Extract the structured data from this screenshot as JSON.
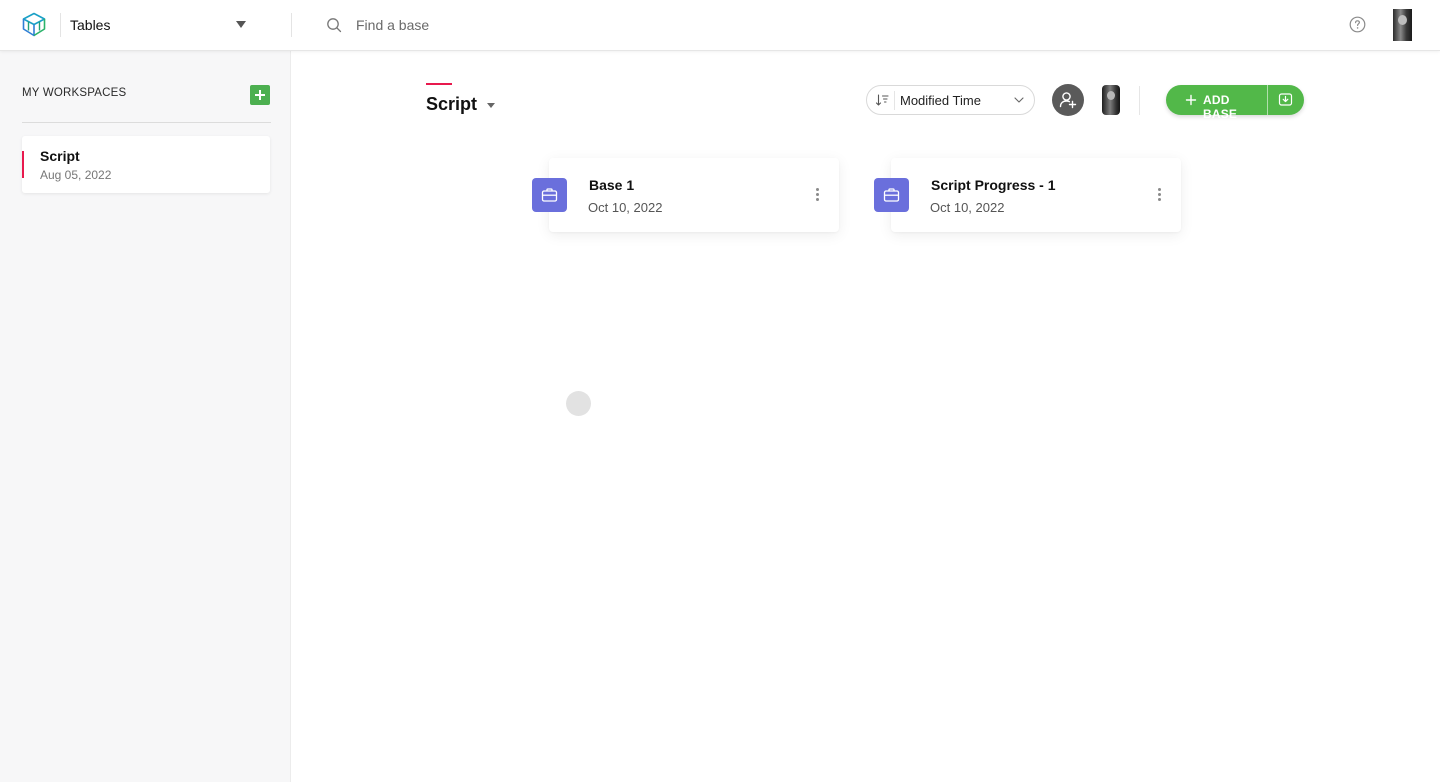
{
  "topbar": {
    "app_name": "Tables",
    "search": {
      "placeholder": "Find a base",
      "value": ""
    }
  },
  "sidebar": {
    "heading": "MY WORKSPACES",
    "workspaces": [
      {
        "name": "Script",
        "date": "Aug 05, 2022",
        "active": true
      }
    ]
  },
  "main": {
    "workspace_title": "Script",
    "sort": {
      "selected": "Modified Time"
    },
    "add_base_label": "ADD BASE",
    "bases": [
      {
        "name": "Base 1",
        "date": "Oct 10, 2022"
      },
      {
        "name": "Script Progress - 1",
        "date": "Oct 10, 2022"
      }
    ]
  },
  "colors": {
    "accent_red": "#e8194d",
    "primary_green": "#52b849",
    "base_badge": "#6a6fdc",
    "sidebar_bg": "#f7f7f8"
  },
  "icons": {
    "logo": "cube-logo-icon",
    "search": "search-icon",
    "help": "help-circle-icon",
    "sort": "sort-descending-icon",
    "chevron": "chevron-down-icon",
    "invite": "user-plus-icon",
    "add": "plus-icon",
    "import": "import-icon",
    "base": "briefcase-icon",
    "more": "more-vertical-icon"
  }
}
